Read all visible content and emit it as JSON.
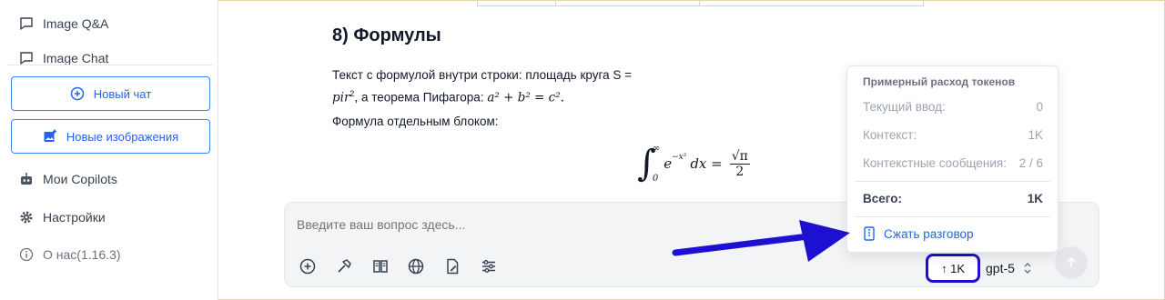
{
  "sidebar": {
    "items_top": [
      {
        "label": "Image Q&A",
        "icon": "chat-bubble-icon"
      },
      {
        "label": "Image Chat",
        "icon": "chat-bubble-icon"
      }
    ],
    "new_chat_label": "Новый чат",
    "new_images_label": "Новые изображения",
    "my_copilots_label": "Мои Copilots",
    "settings_label": "Настройки",
    "about_label": "О нас(1.16.3)"
  },
  "content": {
    "section_title": "8) Формулы",
    "inline_text_1": "Текст с формулой внутри строки: площадь круга S =",
    "inline_math_1": "pir",
    "inline_text_2": ", а теорема Пифагора:",
    "inline_math_2": "a² + b² = c².",
    "block_intro": "Формула отдельным блоком:"
  },
  "input": {
    "placeholder": "Введите ваш вопрос здесь...",
    "token_label": "↑ 1K",
    "model": "gpt-5"
  },
  "token_popover": {
    "title": "Примерный расход токенов",
    "rows": [
      {
        "label": "Текущий ввод:",
        "value": "0"
      },
      {
        "label": "Контекст:",
        "value": "1K"
      },
      {
        "label": "Контекстные сообщения:",
        "value": "2 / 6"
      }
    ],
    "total_label": "Всего:",
    "total_value": "1K",
    "compress_label": "Сжать разговор"
  },
  "colors": {
    "accent": "#2563eb",
    "annotation": "#1d10d0"
  }
}
